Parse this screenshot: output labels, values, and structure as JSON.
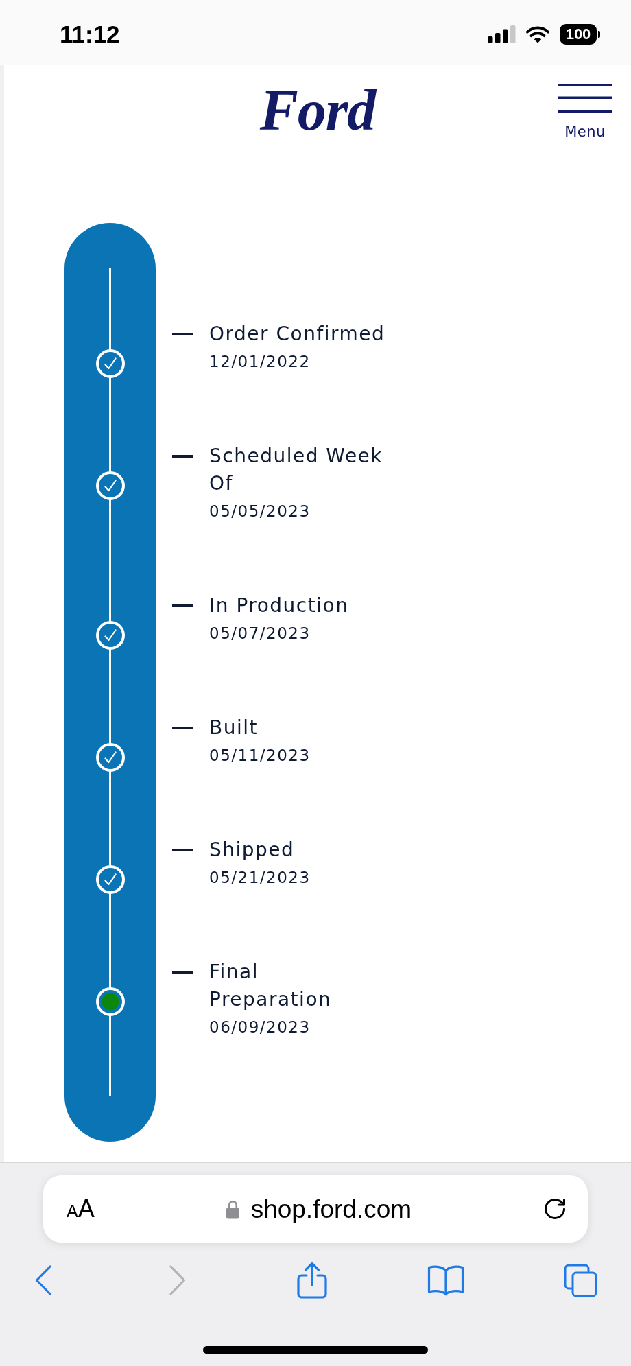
{
  "status_bar": {
    "time": "11:12",
    "battery": "100"
  },
  "header": {
    "logo": "Ford",
    "menu_label": "Menu"
  },
  "milestones": [
    {
      "title": "Order Confirmed",
      "date": "12/01/2022",
      "completed": true
    },
    {
      "title": "Scheduled Week Of",
      "date": "05/05/2023",
      "completed": true
    },
    {
      "title": "In Production",
      "date": "05/07/2023",
      "completed": true
    },
    {
      "title": "Built",
      "date": "05/11/2023",
      "completed": true
    },
    {
      "title": "Shipped",
      "date": "05/21/2023",
      "completed": true
    },
    {
      "title": "Final Preparation",
      "date": "06/09/2023",
      "completed": false
    }
  ],
  "browser": {
    "text_size_label": "AA",
    "url": "shop.ford.com",
    "back_disabled": false,
    "forward_disabled": true
  }
}
